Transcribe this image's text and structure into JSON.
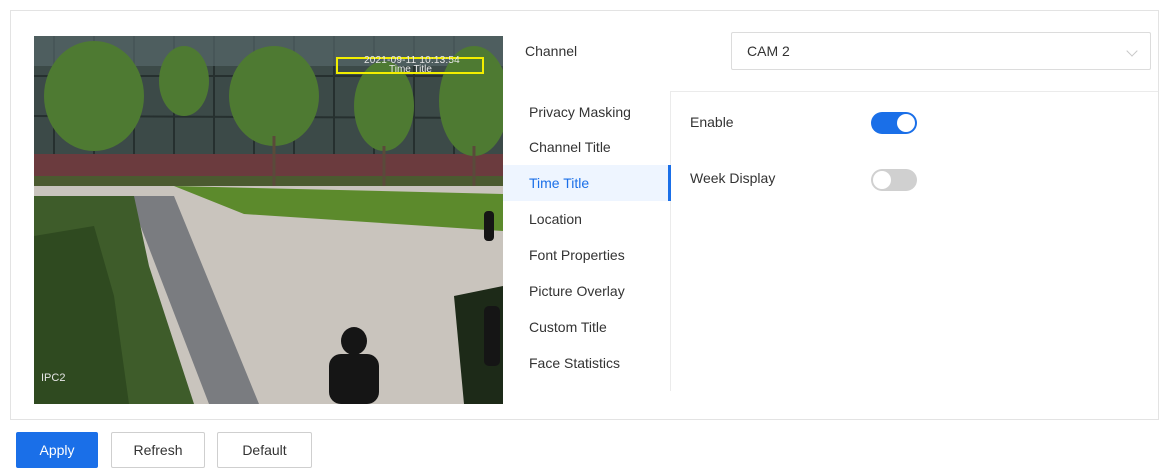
{
  "preview": {
    "osd_time": "2021-09-11 10:13:54",
    "osd_title": "Time Title",
    "osd_channel": "IPC2"
  },
  "channel": {
    "label": "Channel",
    "value": "CAM 2"
  },
  "menu": {
    "items": [
      {
        "label": "Privacy Masking"
      },
      {
        "label": "Channel Title"
      },
      {
        "label": "Time Title"
      },
      {
        "label": "Location"
      },
      {
        "label": "Font Properties"
      },
      {
        "label": "Picture Overlay"
      },
      {
        "label": "Custom Title"
      },
      {
        "label": "Face Statistics"
      }
    ],
    "active_index": 2
  },
  "settings": {
    "enable": {
      "label": "Enable",
      "state": true
    },
    "week_display": {
      "label": "Week Display",
      "state": false
    }
  },
  "buttons": {
    "apply": "Apply",
    "refresh": "Refresh",
    "default": "Default"
  },
  "colors": {
    "accent": "#1a6fe8",
    "osd_box": "#f2ee00"
  }
}
